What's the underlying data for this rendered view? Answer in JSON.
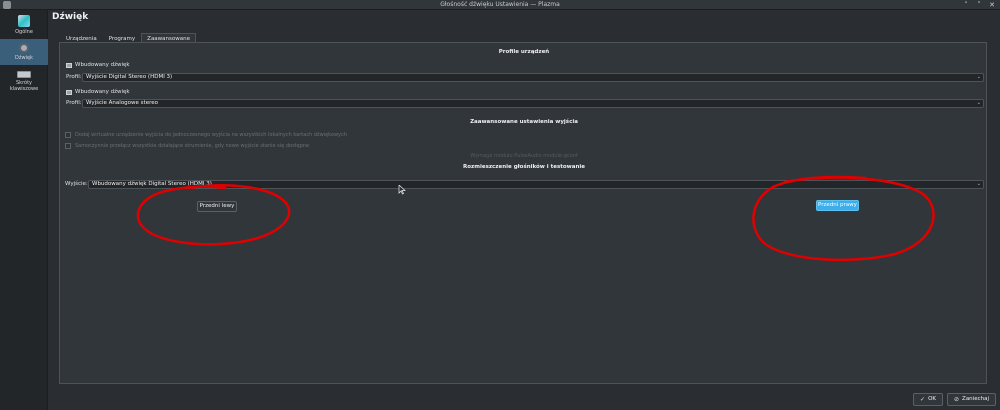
{
  "window": {
    "title": "Głośność dźwięku Ustawienia — Plazma",
    "controls": [
      "˄",
      "˅",
      "✕"
    ]
  },
  "sidebar": {
    "items": [
      {
        "label": "Ogólne",
        "icon": "settings-general-icon"
      },
      {
        "label": "Dźwięk",
        "icon": "speaker-icon",
        "active": true
      },
      {
        "label": "Skróty klawiszowe",
        "icon": "keyboard-icon"
      }
    ]
  },
  "page": {
    "title": "Dźwięk"
  },
  "tabs": [
    {
      "label": "Urządzenia"
    },
    {
      "label": "Programy"
    },
    {
      "label": "Zaawansowane",
      "active": true
    }
  ],
  "profiles": {
    "heading": "Profile urządzeń",
    "devices": [
      {
        "name": "Wbudowany dźwięk",
        "profile_label": "Profil:",
        "profile_value": "Wyjście Digital Stereo (HDMI 3)"
      },
      {
        "name": "Wbudowany dźwięk",
        "profile_label": "Profil:",
        "profile_value": "Wyjście Analogowe stereo"
      }
    ]
  },
  "advanced_output": {
    "heading": "Zaawansowane ustawienia wyjścia",
    "options": [
      {
        "label": "Dodaj wirtualne urządzenie wyjścia do jednoczesnego wyjścia na wszystkich lokalnych kartach dźwiękowych",
        "checked": false,
        "enabled": false
      },
      {
        "label": "Samoczynnie przełącz wszystkie działające strumienie, gdy nowe wyjście stanie się dostępne",
        "checked": false,
        "enabled": false
      }
    ],
    "hint": "Wymaga modułu PulseAudio module-gconf"
  },
  "speaker_placement": {
    "heading": "Rozmieszczenie głośników i testowanie",
    "output_label": "Wyjście:",
    "output_value": "Wbudowany dźwięk Digital Stereo (HDMI 3)",
    "buttons": [
      {
        "label": "Przedni lewy",
        "highlighted": false
      },
      {
        "label": "Przedni prawy",
        "highlighted": true
      }
    ]
  },
  "footer": {
    "ok": "OK",
    "cancel": "Zaniechaj"
  },
  "colors": {
    "accent": "#3daee9",
    "annotation": "#e00000",
    "window_bg": "#2a2e32",
    "panel_bg": "#31363b"
  }
}
